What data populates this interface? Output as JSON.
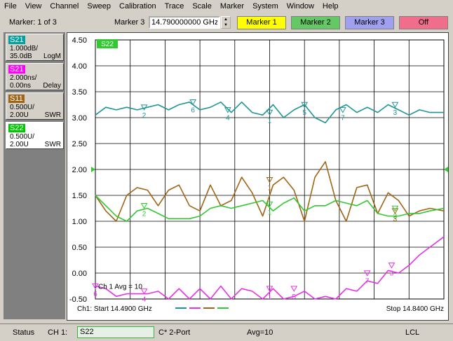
{
  "menu": [
    "File",
    "View",
    "Channel",
    "Sweep",
    "Calibration",
    "Trace",
    "Scale",
    "Marker",
    "System",
    "Window",
    "Help"
  ],
  "toolbar": {
    "marker_count": "Marker: 1 of 3",
    "marker_name": "Marker 3",
    "frequency_value": "14.790000000 GHz",
    "buttons": [
      {
        "label": "Marker 1",
        "color": "#ffff00"
      },
      {
        "label": "Marker 2",
        "color": "#64c864"
      },
      {
        "label": "Marker 3",
        "color": "#a0a0f0"
      },
      {
        "label": "Off",
        "color": "#f06e8c"
      }
    ]
  },
  "traces": [
    {
      "name": "S21",
      "line1": "1.000dB/",
      "line2": "35.0dB",
      "format": "LogM",
      "color": "#00a0a0"
    },
    {
      "name": "S21",
      "line1": "2.000ns/",
      "line2": "0.00ns",
      "format": "Delay",
      "color": "#ff00ff"
    },
    {
      "name": "S11",
      "line1": "0.500U/",
      "line2": "2.00U",
      "format": "SWR",
      "color": "#a06414"
    },
    {
      "name": "S22",
      "line1": "0.500U/",
      "line2": "2.00U",
      "format": "SWR",
      "color": "#00c800"
    }
  ],
  "plot": {
    "active_trace_label": "S22",
    "channel_info": "Ch 1 Avg = 10",
    "start_label": "Ch1: Start  14.4900 GHz",
    "stop_label": "Stop  14.8400 GHz"
  },
  "chart_data": {
    "type": "line",
    "x_start_ghz": 14.49,
    "x_stop_ghz": 14.84,
    "ylim": [
      -0.5,
      4.5
    ],
    "yticks": [
      "4.50",
      "4.00",
      "3.50",
      "3.00",
      "2.50",
      "2.00",
      "1.50",
      "1.00",
      "0.50",
      "0.00",
      "-0.50"
    ],
    "reference_level": 2.0,
    "x": [
      0,
      0.03,
      0.06,
      0.09,
      0.12,
      0.15,
      0.18,
      0.21,
      0.24,
      0.27,
      0.3,
      0.33,
      0.36,
      0.39,
      0.42,
      0.45,
      0.48,
      0.51,
      0.54,
      0.57,
      0.6,
      0.63,
      0.66,
      0.69,
      0.72,
      0.75,
      0.78,
      0.81,
      0.84,
      0.87,
      0.9,
      0.93,
      0.96,
      1.0
    ],
    "series": [
      {
        "name": "S21 LogM",
        "color": "#1e9696",
        "values": [
          3.05,
          3.2,
          3.15,
          3.2,
          3.15,
          3.2,
          3.25,
          3.15,
          3.25,
          3.3,
          3.15,
          3.2,
          3.3,
          3.1,
          3.3,
          3.1,
          3.05,
          3.25,
          3.0,
          3.15,
          3.25,
          3.0,
          2.9,
          3.15,
          3.25,
          3.1,
          3.2,
          3.1,
          3.25,
          3.15,
          3.05,
          3.15,
          3.1,
          3.1
        ]
      },
      {
        "name": "S21 Delay",
        "color": "#e632e6",
        "values": [
          -0.25,
          -0.3,
          -0.45,
          -0.4,
          -0.4,
          -0.4,
          -0.35,
          -0.5,
          -0.3,
          -0.5,
          -0.3,
          -0.5,
          -0.25,
          -0.5,
          -0.3,
          -0.35,
          -0.5,
          -0.3,
          -0.5,
          -0.45,
          -0.35,
          -0.5,
          -0.45,
          -0.5,
          -0.3,
          -0.35,
          -0.15,
          -0.2,
          0.05,
          0.0,
          0.15,
          0.35,
          0.5,
          0.7
        ]
      },
      {
        "name": "S11 SWR",
        "color": "#a06414",
        "values": [
          1.5,
          1.2,
          1.0,
          1.5,
          1.65,
          1.6,
          1.3,
          1.6,
          1.7,
          1.3,
          1.2,
          1.7,
          1.3,
          1.4,
          1.85,
          1.55,
          1.1,
          1.7,
          1.85,
          1.6,
          1.0,
          1.85,
          2.15,
          1.4,
          1.0,
          1.65,
          1.7,
          1.15,
          1.55,
          1.4,
          1.1,
          1.2,
          1.25,
          1.2
        ]
      },
      {
        "name": "S22 SWR",
        "color": "#32c832",
        "values": [
          1.5,
          1.3,
          1.1,
          1.0,
          1.2,
          1.25,
          1.15,
          1.05,
          1.05,
          1.05,
          1.1,
          1.25,
          1.3,
          1.25,
          1.3,
          1.35,
          1.4,
          1.2,
          1.35,
          1.45,
          1.2,
          1.3,
          1.3,
          1.4,
          1.35,
          1.3,
          1.4,
          1.15,
          1.1,
          1.1,
          1.15,
          1.15,
          1.2,
          1.25
        ]
      }
    ],
    "markers": [
      {
        "label": "2",
        "x": 0.14,
        "y": 3.15,
        "color": "#1e9696"
      },
      {
        "label": "6",
        "x": 0.28,
        "y": 3.25,
        "color": "#1e9696"
      },
      {
        "label": "4",
        "x": 0.38,
        "y": 3.1,
        "color": "#1e9696"
      },
      {
        "label": "1",
        "x": 0.5,
        "y": 3.05,
        "color": "#1e9696"
      },
      {
        "label": "5",
        "x": 0.6,
        "y": 3.2,
        "color": "#1e9696"
      },
      {
        "label": "7",
        "x": 0.71,
        "y": 3.1,
        "color": "#1e9696"
      },
      {
        "label": "3",
        "x": 0.86,
        "y": 3.2,
        "color": "#1e9696"
      },
      {
        "label": "6",
        "x": 0.0,
        "y": -0.3,
        "color": "#e632e6"
      },
      {
        "label": "4",
        "x": 0.14,
        "y": -0.4,
        "color": "#e632e6"
      },
      {
        "label": "1",
        "x": 0.5,
        "y": -0.35,
        "color": "#e632e6"
      },
      {
        "label": "5",
        "x": 0.57,
        "y": -0.35,
        "color": "#e632e6"
      },
      {
        "label": "7",
        "x": 0.78,
        "y": -0.05,
        "color": "#e632e6"
      },
      {
        "label": "3",
        "x": 0.85,
        "y": 0.1,
        "color": "#e632e6"
      },
      {
        "label": "1",
        "x": 0.5,
        "y": 1.75,
        "color": "#a06414"
      },
      {
        "label": "3",
        "x": 0.86,
        "y": 1.15,
        "color": "#a06414"
      },
      {
        "label": "2",
        "x": 0.14,
        "y": 1.25,
        "color": "#32c832"
      },
      {
        "label": "1",
        "x": 0.5,
        "y": 1.28,
        "color": "#32c832"
      },
      {
        "label": "3",
        "x": 0.86,
        "y": 1.2,
        "color": "#32c832"
      }
    ]
  },
  "status": {
    "label": "Status",
    "channel": "CH 1:",
    "trace": "S22",
    "cal": "C* 2-Port",
    "avg": "Avg=10",
    "mode": "LCL"
  }
}
